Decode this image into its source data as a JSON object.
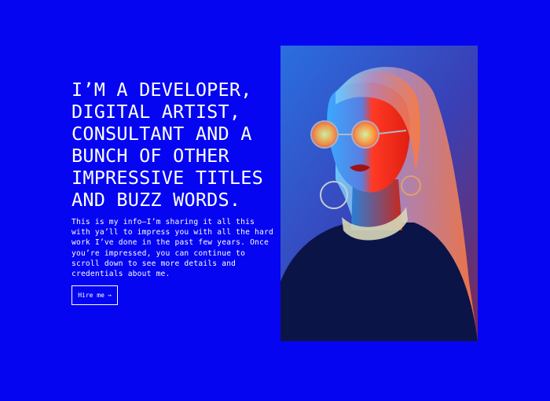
{
  "hero": {
    "headline_lines": [
      "I’M A DEVELOPER,",
      "DIGITAL ARTIST,",
      "CONSULTANT AND A",
      "BUNCH OF OTHER",
      "IMPRESSIVE TITLES",
      "AND BUZZ WORDS."
    ],
    "intro_lines": [
      "This is my info—I’m sharing it all this",
      "with ya’ll to impress you with all the hard",
      "work I’ve done in the past few years. Once",
      "you’re impressed, you can continue to",
      "scroll down to see more details and",
      "credentials about me."
    ],
    "cta": {
      "label": "Hire me",
      "icon": "arrow-right-icon",
      "arrow_glyph": "→"
    }
  },
  "portrait": {
    "image": "portrait-photo"
  },
  "colors": {
    "background": "#0505f2",
    "text": "#ffffff",
    "portrait_red": "#ff3a1f",
    "portrait_cyan": "#3fb0ff",
    "portrait_navy": "#0b1446"
  }
}
